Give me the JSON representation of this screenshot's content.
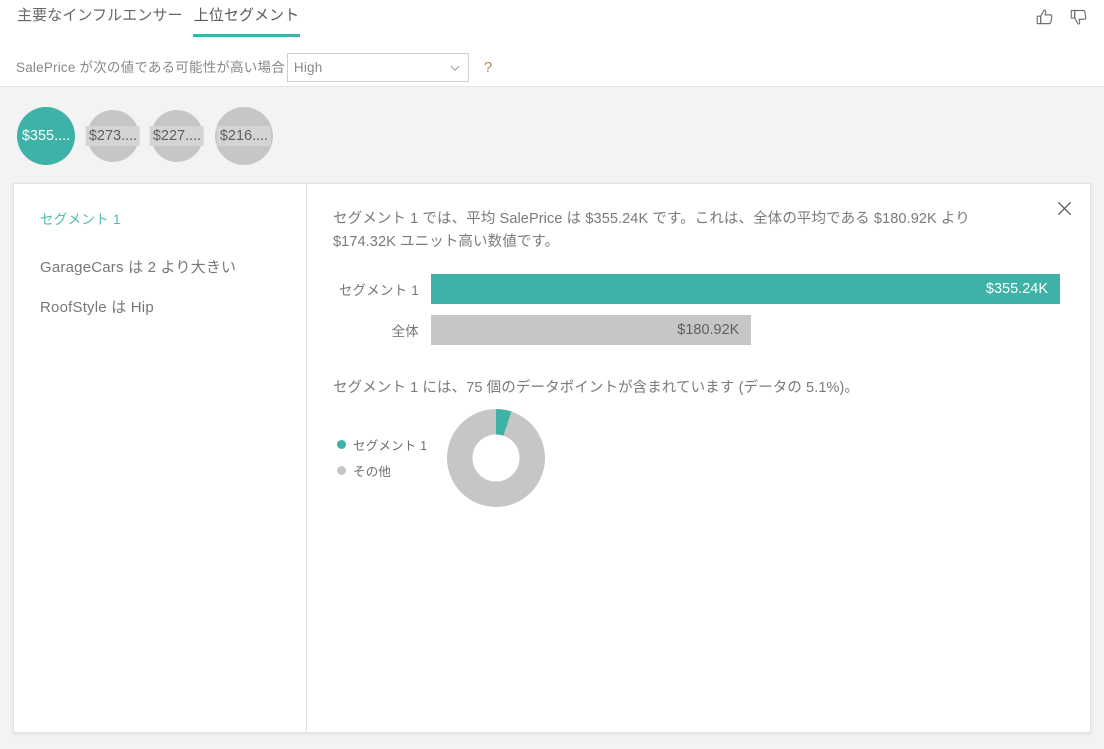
{
  "header": {
    "tabs": [
      {
        "label": "主要なインフルエンサー",
        "selected": false,
        "name": "tab-key-influencers"
      },
      {
        "label": "上位セグメント",
        "selected": true,
        "name": "tab-top-segments"
      }
    ],
    "feedback": {
      "thumbs_up_icon": "thumbs-up-icon",
      "thumbs_down_icon": "thumbs-down-icon"
    }
  },
  "filter": {
    "label": "SalePrice が次の値である可能性が高い場合",
    "dropdown_value": "High",
    "dropdown_placeholder": "High",
    "chevron_icon": "chevron-down-icon",
    "help_label": "?"
  },
  "segments_strip": {
    "bubbles": [
      {
        "label": "$355....",
        "selected": true,
        "size": 58
      },
      {
        "label": "$273....",
        "selected": false,
        "size": 52
      },
      {
        "label": "$227....",
        "selected": false,
        "size": 52
      },
      {
        "label": "$216....",
        "selected": false,
        "size": 58
      }
    ]
  },
  "detail": {
    "left": {
      "heading": "セグメント 1",
      "rules": [
        "GarageCars は 2 より大きい",
        "RoofStyle は Hip"
      ]
    },
    "right": {
      "close_icon": "close-icon",
      "summary": "セグメント 1 では、平均 SalePrice は $355.24K です。これは、全体の平均である $180.92K より $174.32K ユニット高い数値です。",
      "datapoint_text": "セグメント 1 には、75 個のデータポイントが含まれています (データの 5.1%)。"
    }
  },
  "colors": {
    "accent_teal": "#3eb2a6",
    "accent_teal_light": "#4dbcb1",
    "neutral_gray": "#c6c6c6",
    "label_gray": "#d4d4d4",
    "text_gray": "#7a7a7a",
    "page_bg": "#f3f3f3",
    "panel_bg": "#ffffff",
    "help_orange": "#b08a50"
  },
  "chart_data": [
    {
      "type": "bar",
      "title": "",
      "orientation": "horizontal",
      "categories": [
        "セグメント 1",
        "全体"
      ],
      "values": [
        355.24,
        180.92
      ],
      "value_labels": [
        "$355.24K",
        "$180.92K"
      ],
      "colors": [
        "#3eb2a6",
        "#c6c6c6"
      ],
      "xlabel": "",
      "ylabel": "",
      "xlim": [
        0,
        355.24
      ],
      "grid": false,
      "legend": "none"
    },
    {
      "type": "pie",
      "subtype": "donut",
      "title": "",
      "labels": [
        "セグメント 1",
        "その他"
      ],
      "values": [
        5.1,
        94.9
      ],
      "colors": [
        "#3eb2a6",
        "#c6c6c6"
      ],
      "legend": "left",
      "inner_radius_ratio": 0.53,
      "start_angle_deg": 0
    }
  ]
}
